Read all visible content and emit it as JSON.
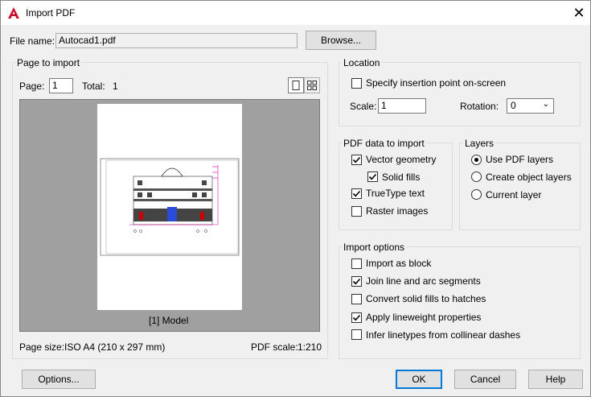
{
  "window": {
    "title": "Import PDF",
    "close_glyph": "✕"
  },
  "file": {
    "label": "File name:",
    "value": "Autocad1.pdf",
    "browse_label": "Browse..."
  },
  "page_import": {
    "group_label": "Page to import",
    "page_label": "Page:",
    "page_value": "1",
    "total_label": "Total:",
    "total_value": "1",
    "preview_caption": "[1] Model",
    "page_size_label": "Page size:",
    "page_size_value": "ISO A4 (210 x 297 mm)",
    "pdf_scale_label": "PDF scale:",
    "pdf_scale_value": "1:210"
  },
  "location": {
    "group_label": "Location",
    "specify_label": "Specify insertion point on-screen",
    "specify_checked": false,
    "scale_label": "Scale:",
    "scale_value": "1",
    "rotation_label": "Rotation:",
    "rotation_value": "0"
  },
  "pdf_data": {
    "group_label": "PDF data to import",
    "items": [
      {
        "label": "Vector geometry",
        "checked": true
      },
      {
        "label": "Solid fills",
        "checked": true
      },
      {
        "label": "TrueType text",
        "checked": true
      },
      {
        "label": "Raster images",
        "checked": false
      }
    ]
  },
  "layers": {
    "group_label": "Layers",
    "items": [
      {
        "label": "Use PDF layers",
        "selected": true
      },
      {
        "label": "Create object layers",
        "selected": false
      },
      {
        "label": "Current layer",
        "selected": false
      }
    ]
  },
  "import_options": {
    "group_label": "Import options",
    "items": [
      {
        "label": "Import as block",
        "checked": false
      },
      {
        "label": "Join line and arc segments",
        "checked": true
      },
      {
        "label": "Convert solid fills to hatches",
        "checked": false
      },
      {
        "label": "Apply lineweight properties",
        "checked": true
      },
      {
        "label": "Infer linetypes from collinear dashes",
        "checked": false
      }
    ]
  },
  "footer": {
    "options_label": "Options...",
    "ok_label": "OK",
    "cancel_label": "Cancel",
    "help_label": "Help"
  },
  "colors": {
    "accent": "#0078d7",
    "app_icon": "#c8102e"
  }
}
